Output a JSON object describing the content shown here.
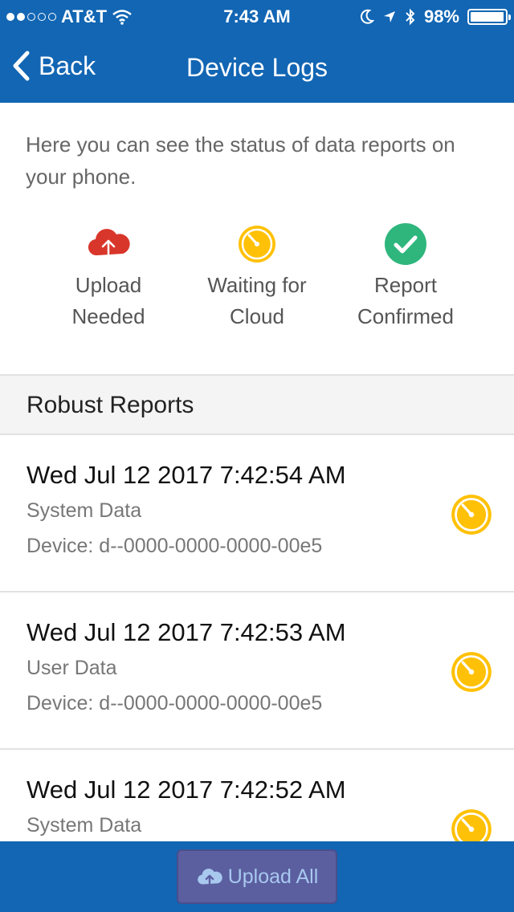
{
  "status_bar": {
    "carrier": "AT&T",
    "time": "7:43 AM",
    "battery": "98%",
    "battery_level": 0.98
  },
  "navbar": {
    "back_label": "Back",
    "title": "Device Logs"
  },
  "intro": "Here you can see the status of data reports on your phone.",
  "legend": [
    {
      "line1": "Upload",
      "line2": "Needed",
      "icon": "cloud-upload-icon"
    },
    {
      "line1": "Waiting for",
      "line2": "Cloud",
      "icon": "timer-icon"
    },
    {
      "line1": "Report",
      "line2": "Confirmed",
      "icon": "check-circle-icon"
    }
  ],
  "section_title": "Robust Reports",
  "reports": [
    {
      "date": "Wed Jul 12 2017 7:42:54 AM",
      "type": "System Data",
      "device": "Device: d--0000-0000-0000-00e5",
      "status": "timer-icon"
    },
    {
      "date": "Wed Jul 12 2017 7:42:53 AM",
      "type": "User Data",
      "device": "Device: d--0000-0000-0000-00e5",
      "status": "timer-icon"
    },
    {
      "date": "Wed Jul 12 2017 7:42:52 AM",
      "type": "System Data",
      "device": "",
      "status": "timer-icon"
    }
  ],
  "bottom": {
    "upload_all_label": "Upload All"
  },
  "colors": {
    "primary": "#1266b4",
    "upload_needed": "#d9362b",
    "waiting": "#ffc107",
    "confirmed": "#2eb67d"
  }
}
